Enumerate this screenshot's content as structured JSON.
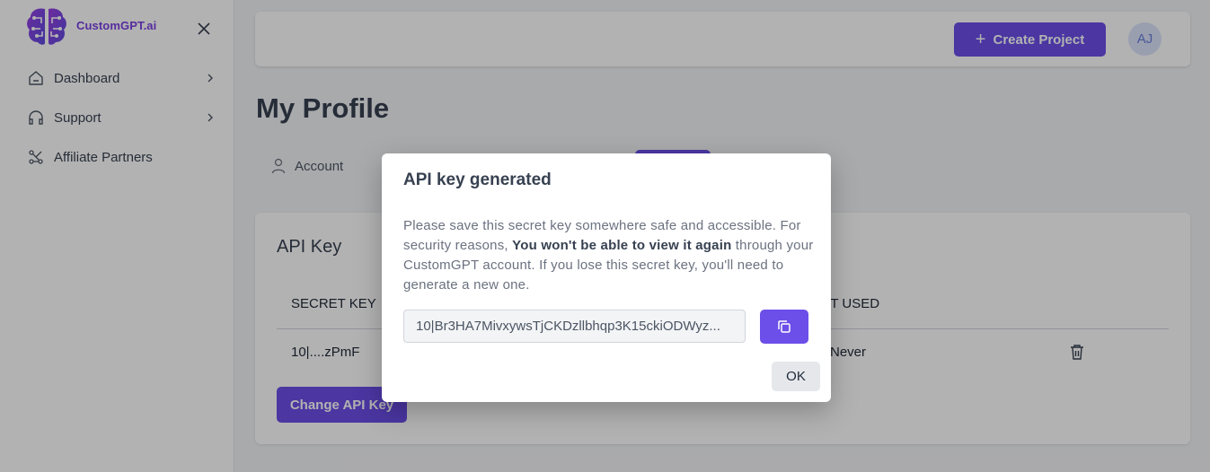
{
  "brand": {
    "name": "CustomGPT.ai",
    "accent": "#6c4ee8",
    "logo_color": "#7b3fe4"
  },
  "sidebar": {
    "items": [
      {
        "label": "Dashboard",
        "icon": "home-icon",
        "has_chevron": true
      },
      {
        "label": "Support",
        "icon": "headphones-icon",
        "has_chevron": true
      },
      {
        "label": "Affiliate Partners",
        "icon": "network-icon",
        "has_chevron": false
      }
    ]
  },
  "header": {
    "create_label": "Create Project",
    "avatar_initials": "AJ"
  },
  "page": {
    "title": "My Profile"
  },
  "tabs": {
    "account_label": "Account"
  },
  "api_card": {
    "title": "API Key",
    "col_secret": "SECRET KEY",
    "col_last_used": "LAST USED",
    "row": {
      "secret": "10|....zPmF",
      "last_used": "Never"
    },
    "change_label": "Change API Key"
  },
  "modal": {
    "title": "API key generated",
    "body_pre": "Please save this secret key somewhere safe and accessible. For security reasons, ",
    "body_bold": "You won't be able to view it again",
    "body_post": " through your CustomGPT account. If you lose this secret key, you'll need to generate a new one.",
    "key_value": "10|Br3HA7MivxywsTjCKDzllbhqp3K15ckiODWyz...",
    "ok_label": "OK"
  }
}
